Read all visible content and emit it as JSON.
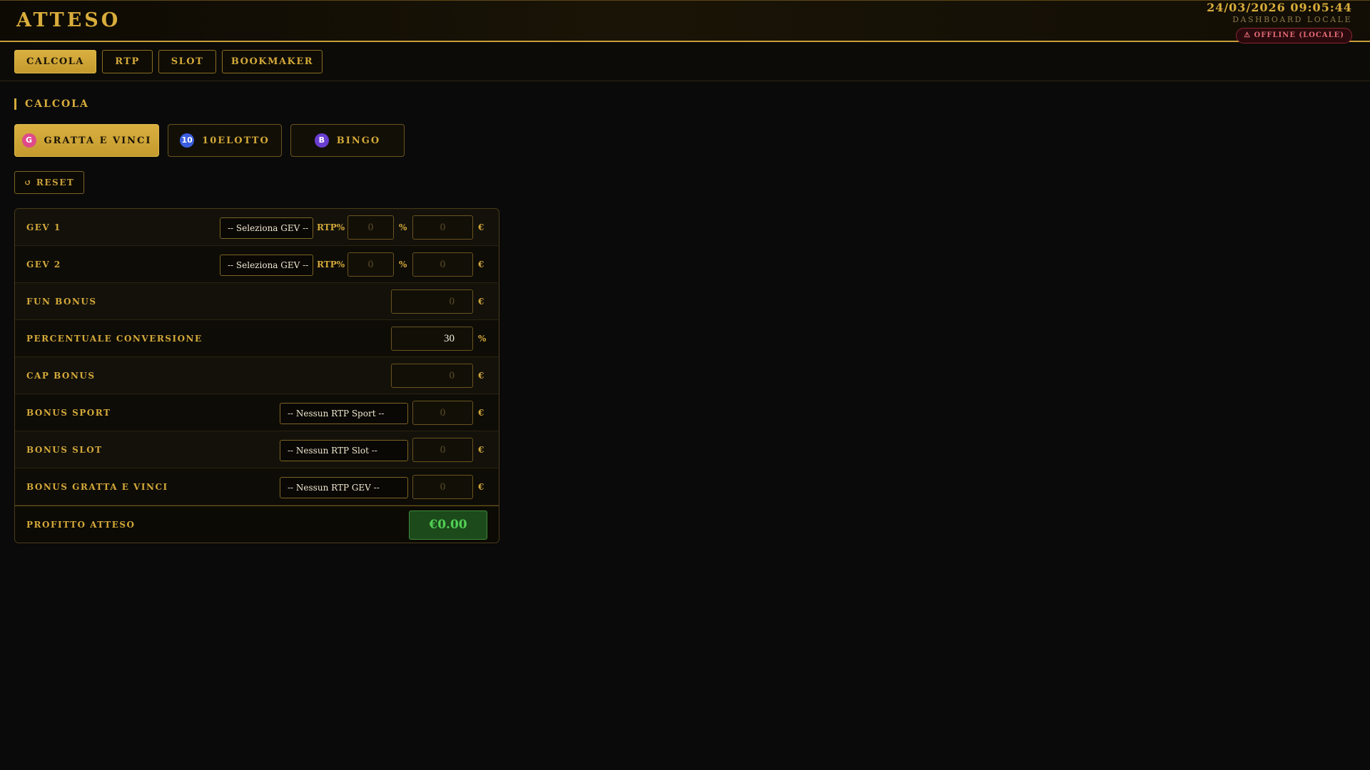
{
  "header": {
    "title": "ATTESO",
    "datetime": "24/03/2026 09:05:44",
    "subtitle": "DASHBOARD LOCALE",
    "status": "⚠ OFFLINE (LOCALE)",
    "accent_color": "#d4a93a"
  },
  "nav": {
    "tabs": [
      {
        "label": "CALCOLA",
        "active": true
      },
      {
        "label": "RTP",
        "active": false
      },
      {
        "label": "SLOT",
        "active": false
      },
      {
        "label": "BOOKMAKER",
        "active": false
      }
    ]
  },
  "section": {
    "title": "CALCOLA"
  },
  "games": [
    {
      "icon": "G",
      "label": "GRATTA E VINCI",
      "icon_color": "#e04a8a",
      "active": true
    },
    {
      "icon": "10",
      "label": "10ELOTTO",
      "icon_color": "#3b5ee0",
      "active": false
    },
    {
      "icon": "B",
      "label": "BINGO",
      "icon_color": "#6a3ed0",
      "active": false
    }
  ],
  "reset_label": "↺ RESET",
  "form": {
    "gev1": {
      "label": "GEV 1",
      "select": "-- Seleziona GEV --",
      "rtp_label": "RTP%",
      "rtp_value": "0",
      "rtp_unit": "%",
      "amount": "0",
      "amount_unit": "€"
    },
    "gev2": {
      "label": "GEV 2",
      "select": "-- Seleziona GEV --",
      "rtp_label": "RTP%",
      "rtp_value": "0",
      "rtp_unit": "%",
      "amount": "0",
      "amount_unit": "€"
    },
    "fun_bonus": {
      "label": "FUN BONUS",
      "value": "0",
      "unit": "€"
    },
    "conversione": {
      "label": "PERCENTUALE CONVERSIONE",
      "value": "30",
      "unit": "%"
    },
    "cap_bonus": {
      "label": "CAP BONUS",
      "value": "0",
      "unit": "€"
    },
    "bonus_sport": {
      "label": "BONUS SPORT",
      "select": "-- Nessun RTP Sport --",
      "value": "0",
      "unit": "€"
    },
    "bonus_slot": {
      "label": "BONUS SLOT",
      "select": "-- Nessun RTP Slot --",
      "value": "0",
      "unit": "€"
    },
    "bonus_gev": {
      "label": "BONUS GRATTA E VINCI",
      "select": "-- Nessun RTP GEV --",
      "value": "0",
      "unit": "€"
    },
    "profitto": {
      "label": "PROFITTO ATTESO",
      "value": "€0.00"
    }
  }
}
